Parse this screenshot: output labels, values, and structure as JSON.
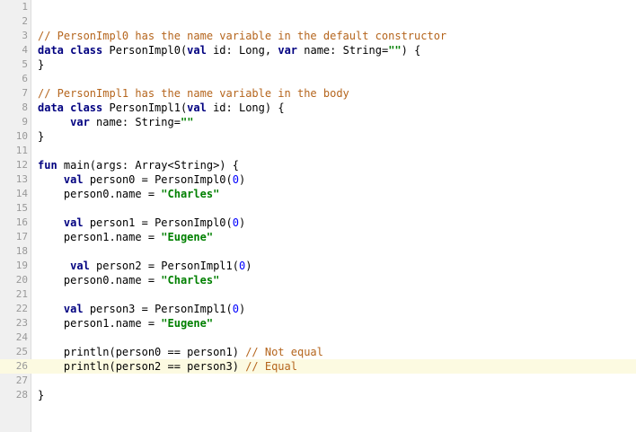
{
  "editor": {
    "colors": {
      "keyword": "#000080",
      "string": "#008000",
      "number": "#0000ff",
      "comment_gray": "#808080",
      "comment_orange": "#b5651d",
      "current_line": "#fcfae1",
      "gutter": "#f0f0f0"
    },
    "current_line": 26,
    "lines": [
      {
        "n": "1",
        "tokens": []
      },
      {
        "n": "2",
        "tokens": []
      },
      {
        "n": "3",
        "tokens": [
          [
            "doc",
            "// PersonImpl0 has the name variable in the default constructor"
          ]
        ]
      },
      {
        "n": "4",
        "tokens": [
          [
            "kw",
            "data class"
          ],
          [
            "plain",
            " PersonImpl0("
          ],
          [
            "kw",
            "val"
          ],
          [
            "plain",
            " id: Long, "
          ],
          [
            "kw",
            "var"
          ],
          [
            "plain",
            " name: String="
          ],
          [
            "str",
            "\"\""
          ],
          [
            "plain",
            ") {"
          ]
        ]
      },
      {
        "n": "5",
        "tokens": [
          [
            "plain",
            "}"
          ]
        ]
      },
      {
        "n": "6",
        "tokens": []
      },
      {
        "n": "7",
        "tokens": [
          [
            "doc",
            "// PersonImpl1 has the name variable in the body"
          ]
        ]
      },
      {
        "n": "8",
        "tokens": [
          [
            "kw",
            "data class"
          ],
          [
            "plain",
            " PersonImpl1("
          ],
          [
            "kw",
            "val"
          ],
          [
            "plain",
            " id: Long) {"
          ]
        ]
      },
      {
        "n": "9",
        "tokens": [
          [
            "plain",
            "     "
          ],
          [
            "kw",
            "var"
          ],
          [
            "plain",
            " name: String="
          ],
          [
            "str",
            "\"\""
          ]
        ]
      },
      {
        "n": "10",
        "tokens": [
          [
            "plain",
            "}"
          ]
        ]
      },
      {
        "n": "11",
        "tokens": []
      },
      {
        "n": "12",
        "tokens": [
          [
            "kw",
            "fun"
          ],
          [
            "plain",
            " main(args: Array<String>) {"
          ]
        ]
      },
      {
        "n": "13",
        "tokens": [
          [
            "plain",
            "    "
          ],
          [
            "kw",
            "val"
          ],
          [
            "plain",
            " person0 = PersonImpl0("
          ],
          [
            "num",
            "0"
          ],
          [
            "plain",
            ")"
          ]
        ]
      },
      {
        "n": "14",
        "tokens": [
          [
            "plain",
            "    person0.name = "
          ],
          [
            "str",
            "\"Charles\""
          ]
        ]
      },
      {
        "n": "15",
        "tokens": []
      },
      {
        "n": "16",
        "tokens": [
          [
            "plain",
            "    "
          ],
          [
            "kw",
            "val"
          ],
          [
            "plain",
            " person1 = PersonImpl0("
          ],
          [
            "num",
            "0"
          ],
          [
            "plain",
            ")"
          ]
        ]
      },
      {
        "n": "17",
        "tokens": [
          [
            "plain",
            "    person1.name = "
          ],
          [
            "str",
            "\"Eugene\""
          ]
        ]
      },
      {
        "n": "18",
        "tokens": []
      },
      {
        "n": "19",
        "tokens": [
          [
            "plain",
            "     "
          ],
          [
            "kw",
            "val"
          ],
          [
            "plain",
            " person2 = PersonImpl1("
          ],
          [
            "num",
            "0"
          ],
          [
            "plain",
            ")"
          ]
        ]
      },
      {
        "n": "20",
        "tokens": [
          [
            "plain",
            "    person0.name = "
          ],
          [
            "str",
            "\"Charles\""
          ]
        ]
      },
      {
        "n": "21",
        "tokens": []
      },
      {
        "n": "22",
        "tokens": [
          [
            "plain",
            "    "
          ],
          [
            "kw",
            "val"
          ],
          [
            "plain",
            " person3 = PersonImpl1("
          ],
          [
            "num",
            "0"
          ],
          [
            "plain",
            ")"
          ]
        ]
      },
      {
        "n": "23",
        "tokens": [
          [
            "plain",
            "    person1.name = "
          ],
          [
            "str",
            "\"Eugene\""
          ]
        ]
      },
      {
        "n": "24",
        "tokens": []
      },
      {
        "n": "25",
        "tokens": [
          [
            "plain",
            "    println(person0 == person1) "
          ],
          [
            "doc",
            "// Not equal"
          ]
        ]
      },
      {
        "n": "26",
        "tokens": [
          [
            "plain",
            "    println(person2 == person3) "
          ],
          [
            "doc",
            "// Equal"
          ]
        ]
      },
      {
        "n": "27",
        "tokens": []
      },
      {
        "n": "28",
        "tokens": [
          [
            "plain",
            "}"
          ]
        ]
      }
    ]
  }
}
